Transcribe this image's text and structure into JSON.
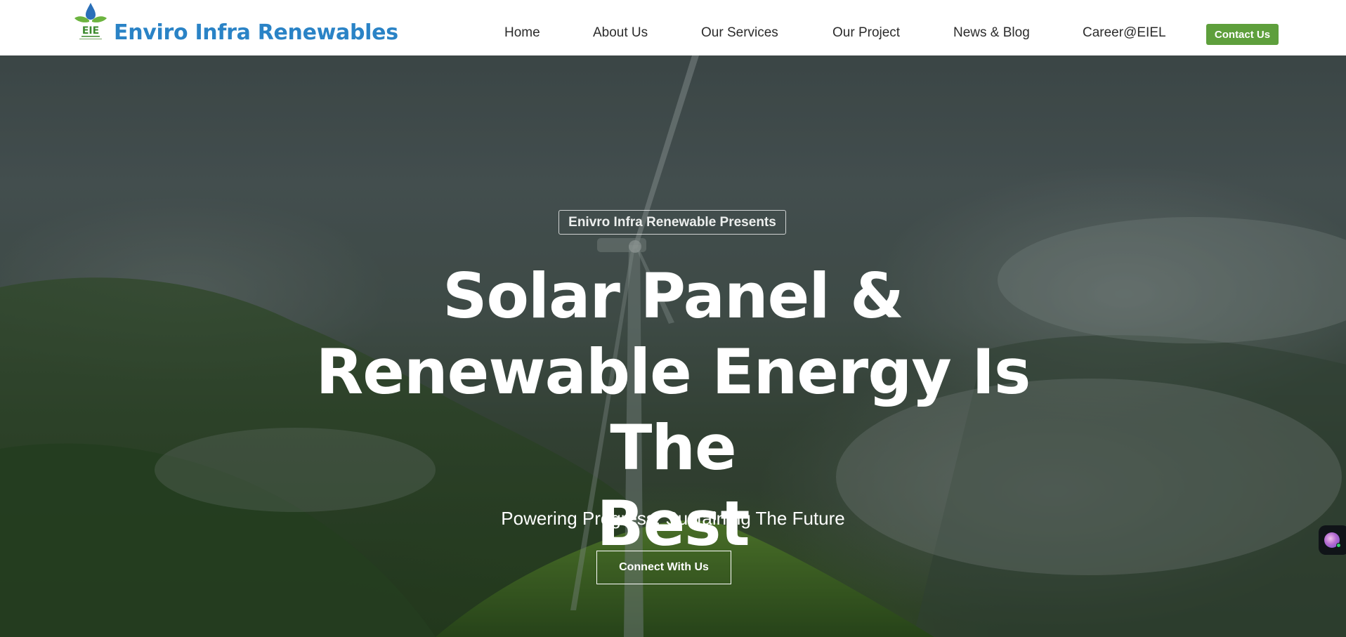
{
  "header": {
    "brand": "Enviro Infra Renewables",
    "logo_text": "EIE",
    "nav": [
      {
        "label": "Home"
      },
      {
        "label": "About Us"
      },
      {
        "label": "Our Services"
      },
      {
        "label": "Our Project"
      },
      {
        "label": "News & Blog"
      },
      {
        "label": "Career@EIEL"
      }
    ],
    "contact_label": "Contact Us"
  },
  "hero": {
    "tag": "Enivro Infra Renewable Presents",
    "title_line1": "Solar Panel &",
    "title_line2": "Renewable Energy Is The",
    "title_line3": "Best",
    "subtitle": "Powering Progress, Sustaining The Future",
    "cta_label": "Connect With Us"
  },
  "colors": {
    "brand_blue": "#2a83c6",
    "accent_green": "#5e9f3c"
  }
}
